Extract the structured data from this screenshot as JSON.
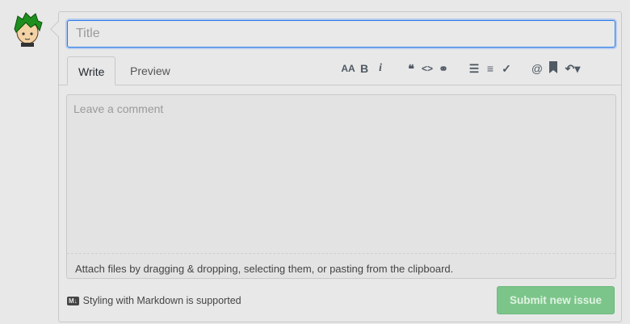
{
  "title_input": {
    "placeholder": "Title",
    "value": ""
  },
  "tabs": {
    "write": "Write",
    "preview": "Preview"
  },
  "toolbar": [
    {
      "icon": "text-size-icon",
      "glyph": "AA"
    },
    {
      "icon": "bold-icon",
      "glyph": "B"
    },
    {
      "icon": "italic-icon",
      "glyph": "i"
    },
    {
      "icon": "quote-icon",
      "glyph": "❝"
    },
    {
      "icon": "code-icon",
      "glyph": "<>"
    },
    {
      "icon": "link-icon",
      "glyph": "⚭"
    },
    {
      "icon": "unordered-list-icon",
      "glyph": "☰"
    },
    {
      "icon": "ordered-list-icon",
      "glyph": "≡"
    },
    {
      "icon": "task-list-icon",
      "glyph": "✓"
    },
    {
      "icon": "mention-icon",
      "glyph": "@"
    },
    {
      "icon": "saved-reply-icon",
      "glyph": "🔖"
    },
    {
      "icon": "reply-icon",
      "glyph": "↶▾"
    }
  ],
  "comment": {
    "placeholder": "Leave a comment",
    "attach_text": "Attach files by dragging & dropping, selecting them, or pasting from the clipboard."
  },
  "footer": {
    "markdown_badge": "M↓",
    "markdown_text": "Styling with Markdown is supported",
    "submit_label": "Submit new issue"
  }
}
